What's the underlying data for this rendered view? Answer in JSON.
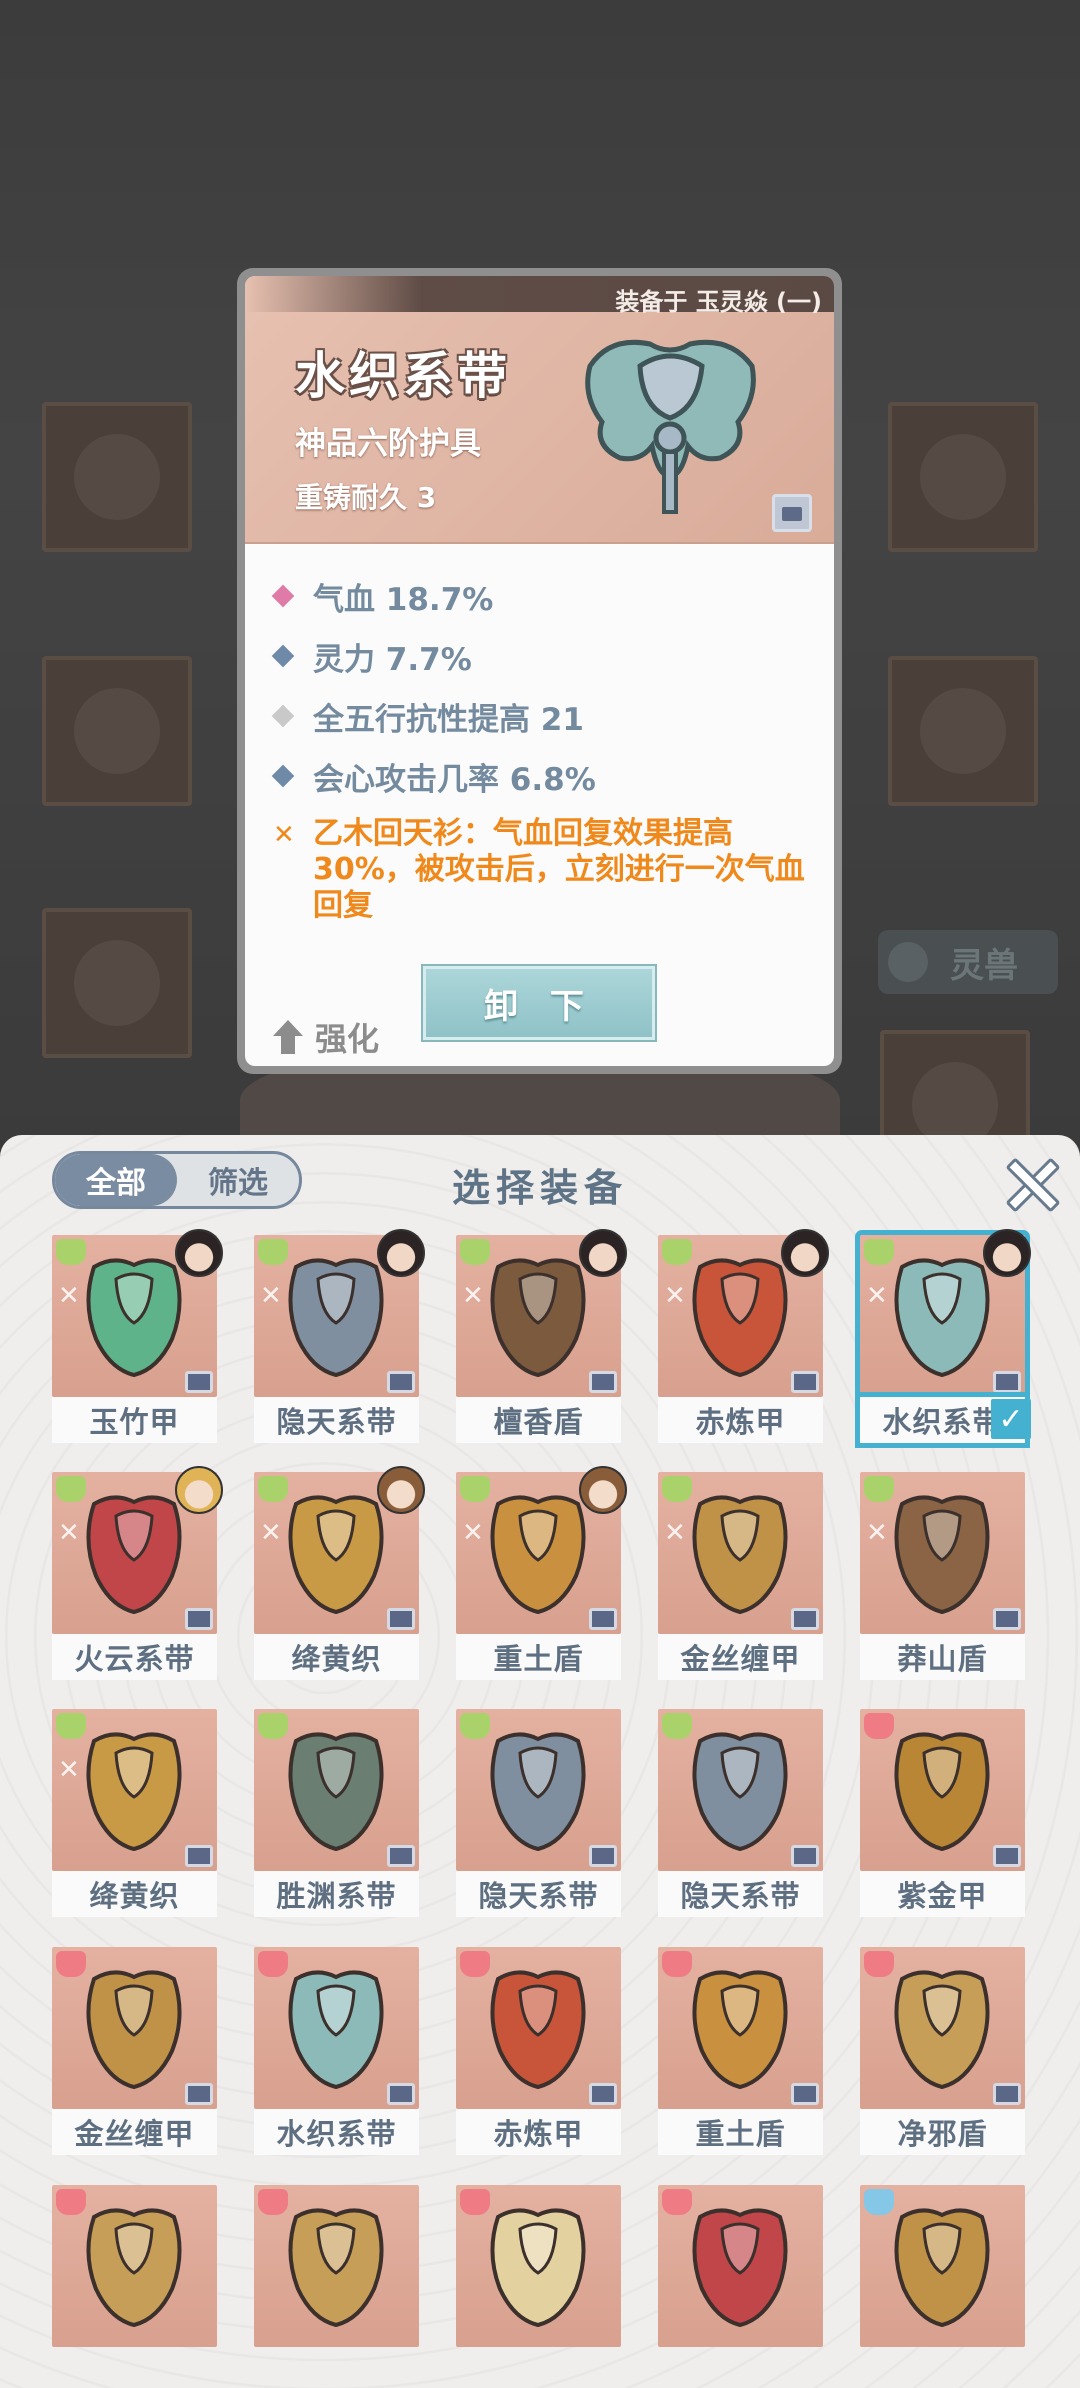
{
  "background": {
    "tag_label": "灵兽"
  },
  "detail": {
    "equipped_on": "装备于 玉灵焱 (一)",
    "name": "水织系带",
    "grade": "神品六阶护具",
    "recast": "重铸耐久 3",
    "stats": [
      {
        "text": "气血 18.7%",
        "color": "#e07aa6"
      },
      {
        "text": "灵力 7.7%",
        "color": "#6f89a8"
      },
      {
        "text": "全五行抗性提高 21",
        "color": "#c9c9c9"
      },
      {
        "text": "会心攻击几率 6.8%",
        "color": "#6f89a8"
      }
    ],
    "special": "乙木回天衫：气血回复效果提高30%，被攻击后，立刻进行一次气血回复",
    "enhance_label": "强化",
    "unequip_label": "卸 下"
  },
  "panel": {
    "tabs": [
      "全部",
      "筛选"
    ],
    "active_tab": 0,
    "title": "选择装备",
    "items": [
      {
        "name": "玉竹甲",
        "quality": "green",
        "avatar": "dark",
        "color": "#5fb38a"
      },
      {
        "name": "隐天系带",
        "quality": "green",
        "avatar": "dark",
        "color": "#7f8fa0"
      },
      {
        "name": "檀香盾",
        "quality": "green",
        "avatar": "dark",
        "color": "#7b5a3e"
      },
      {
        "name": "赤炼甲",
        "quality": "green",
        "avatar": "dark",
        "color": "#c8553a"
      },
      {
        "name": "水织系带",
        "quality": "green",
        "avatar": "dark",
        "color": "#8bbab8",
        "selected": true
      },
      {
        "name": "火云系带",
        "quality": "green",
        "avatar": "blond",
        "color": "#c0464a"
      },
      {
        "name": "绛黄织",
        "quality": "green",
        "avatar": "brown",
        "color": "#c99a45"
      },
      {
        "name": "重土盾",
        "quality": "green",
        "avatar": "brown",
        "color": "#c9913f"
      },
      {
        "name": "金丝缠甲",
        "quality": "green",
        "color": "#c09248"
      },
      {
        "name": "莽山盾",
        "quality": "green",
        "color": "#8a6444"
      },
      {
        "name": "绛黄织",
        "quality": "green",
        "color": "#c99a45"
      },
      {
        "name": "胜渊系带",
        "quality": "green",
        "color": "#6a7f71"
      },
      {
        "name": "隐天系带",
        "quality": "green",
        "color": "#7f8fa0"
      },
      {
        "name": "隐天系带",
        "quality": "green",
        "color": "#7f8fa0"
      },
      {
        "name": "紫金甲",
        "quality": "red",
        "color": "#b98636"
      },
      {
        "name": "金丝缠甲",
        "quality": "red",
        "color": "#c09248"
      },
      {
        "name": "水织系带",
        "quality": "red",
        "color": "#8bbab8"
      },
      {
        "name": "赤炼甲",
        "quality": "red",
        "color": "#c8553a"
      },
      {
        "name": "重土盾",
        "quality": "red",
        "color": "#c9913f"
      },
      {
        "name": "净邪盾",
        "quality": "red",
        "color": "#c79e58"
      },
      {
        "name": "",
        "quality": "red",
        "color": "#c79e58"
      },
      {
        "name": "",
        "quality": "red",
        "color": "#c79e58"
      },
      {
        "name": "",
        "quality": "red",
        "color": "#e3d2a0"
      },
      {
        "name": "",
        "quality": "red",
        "color": "#c0464a"
      },
      {
        "name": "",
        "quality": "blue",
        "color": "#c09248"
      }
    ]
  }
}
